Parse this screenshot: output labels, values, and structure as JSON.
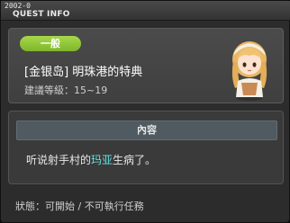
{
  "window": {
    "quest_id": "2002-0",
    "title": "QUEST INFO"
  },
  "quest": {
    "category_badge": "一般",
    "name": "[金银岛] 明珠港的特典",
    "level_requirement": "建議等級：15~19",
    "npc_icon": "npc-girl-portrait"
  },
  "content": {
    "header": "內容",
    "text_before": "听说射手村的",
    "highlight_name": "玛亚",
    "text_after": "生病了。"
  },
  "status": {
    "text": "狀態：可開始 / 不可執行任務"
  },
  "colors": {
    "badge": "#8cc63f",
    "highlight": "#66e0e0",
    "window_bg": "#2c2c2c"
  }
}
